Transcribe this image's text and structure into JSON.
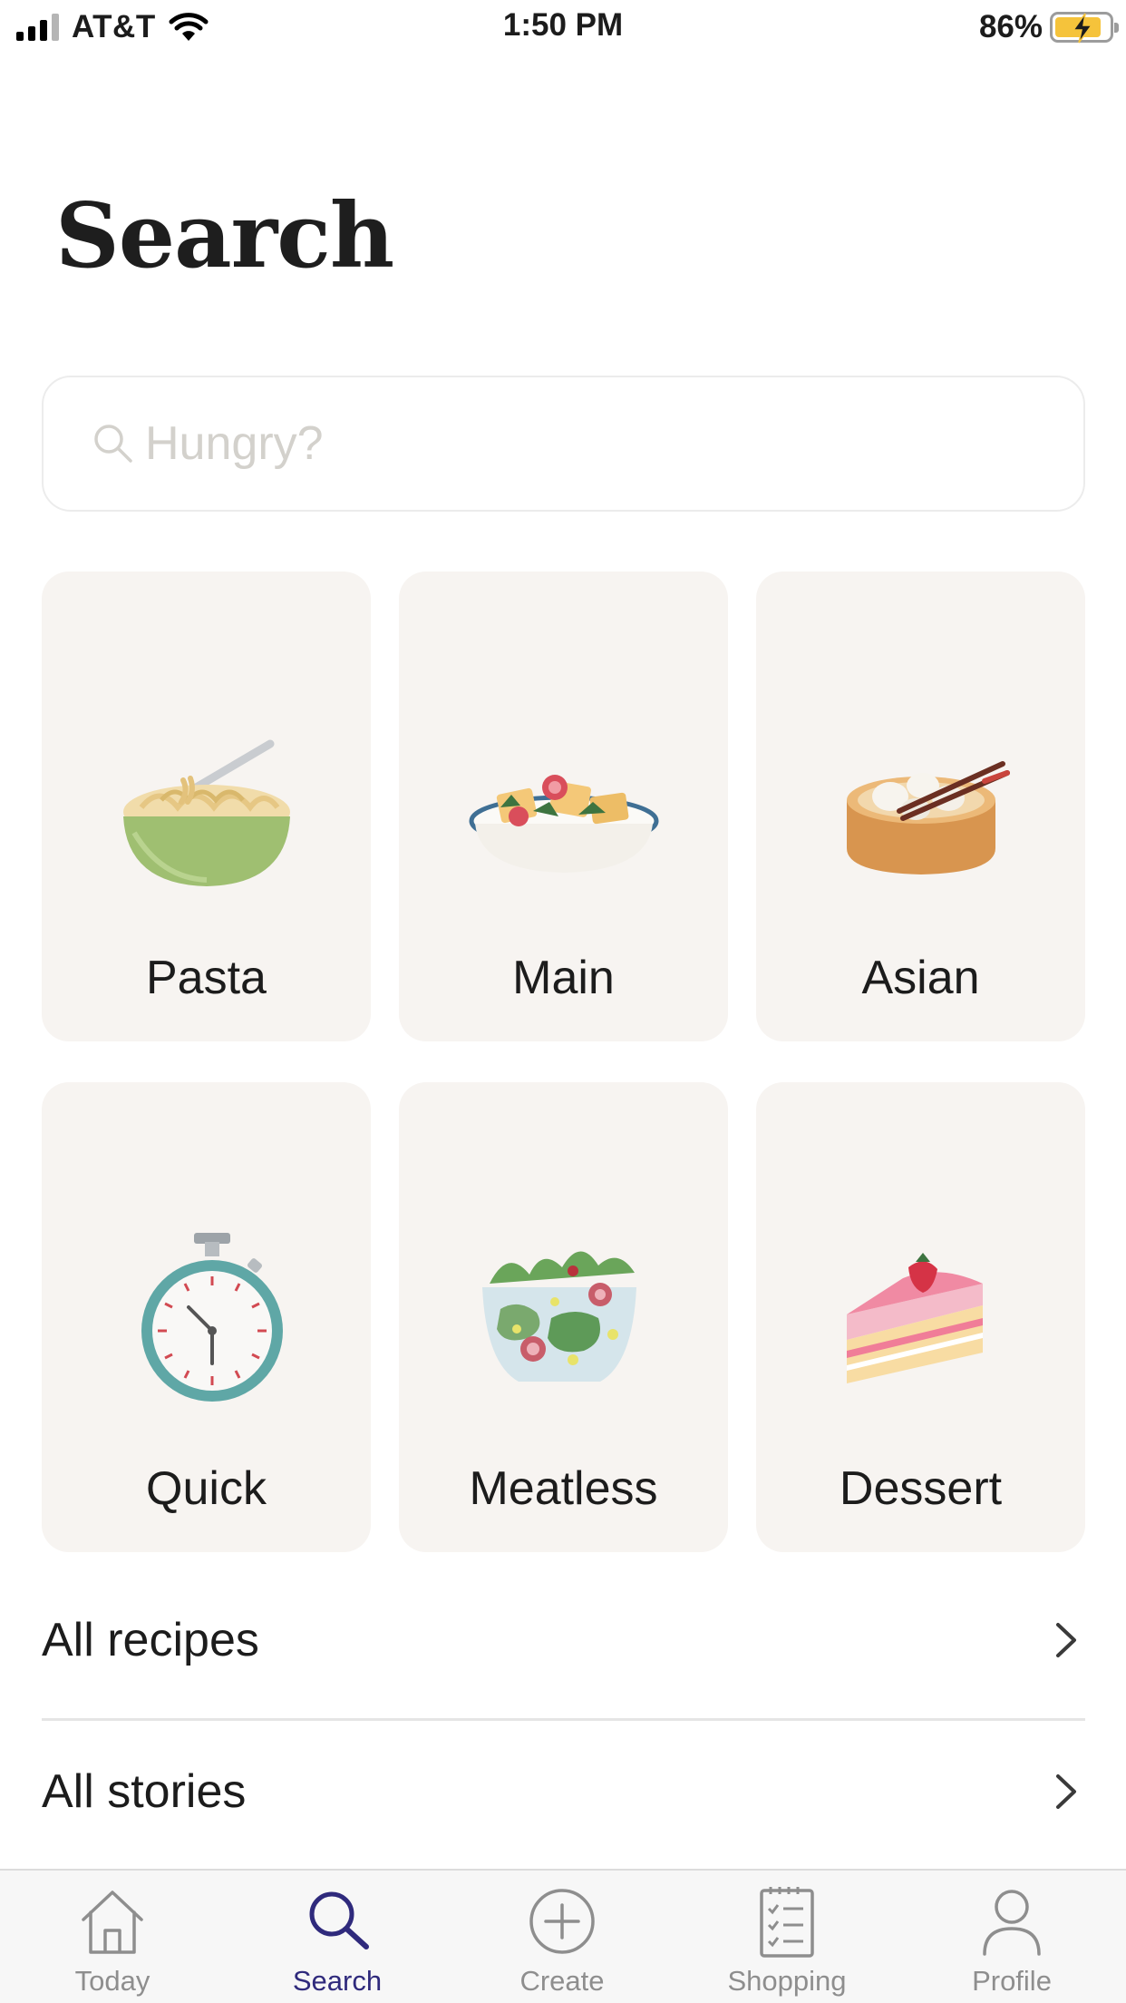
{
  "status_bar": {
    "carrier": "AT&T",
    "time": "1:50 PM",
    "battery_percent": "86%",
    "battery_level": 0.86,
    "battery_color": "#f5c33b",
    "icons": [
      "signal-icon",
      "wifi-icon",
      "battery-charging-icon"
    ]
  },
  "page": {
    "title": "Search"
  },
  "search": {
    "placeholder": "Hungry?",
    "value": "",
    "icon": "search-icon"
  },
  "categories": [
    {
      "label": "Pasta",
      "icon": "pasta-bowl-icon"
    },
    {
      "label": "Main",
      "icon": "salad-plate-icon"
    },
    {
      "label": "Asian",
      "icon": "dumpling-basket-icon"
    },
    {
      "label": "Quick",
      "icon": "stopwatch-icon"
    },
    {
      "label": "Meatless",
      "icon": "salad-bowl-icon"
    },
    {
      "label": "Dessert",
      "icon": "cake-slice-icon"
    }
  ],
  "links": [
    {
      "label": "All recipes",
      "icon": "chevron-right-icon"
    },
    {
      "label": "All stories",
      "icon": "chevron-right-icon"
    }
  ],
  "tab_bar": {
    "active": "Search",
    "active_color": "#2f2a7c",
    "inactive_color": "#8e8e8e",
    "tabs": [
      {
        "label": "Today",
        "icon": "home-icon"
      },
      {
        "label": "Search",
        "icon": "search-icon"
      },
      {
        "label": "Create",
        "icon": "plus-circle-icon"
      },
      {
        "label": "Shopping",
        "icon": "checklist-icon"
      },
      {
        "label": "Profile",
        "icon": "person-icon"
      }
    ]
  }
}
